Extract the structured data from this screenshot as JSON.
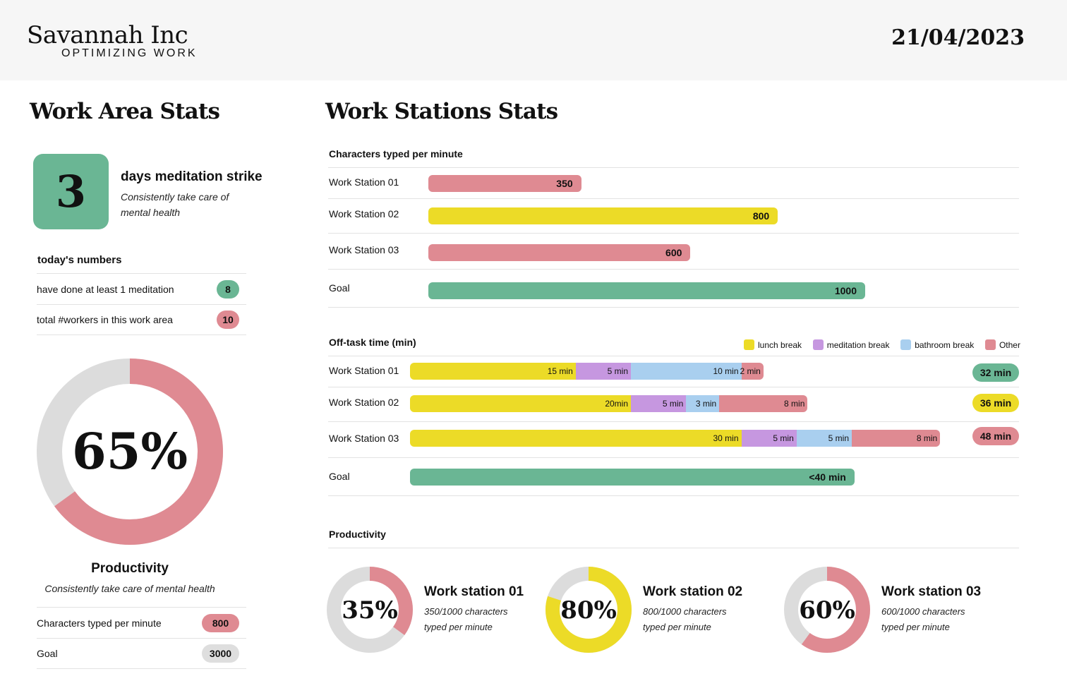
{
  "header": {
    "brand": "Savannah Inc",
    "tagline": "OPTIMIZING WORK",
    "date": "21/04/2023"
  },
  "work_area": {
    "title": "Work Area Stats",
    "streak": {
      "value": "3",
      "title": "days meditation strike",
      "subtitle": "Consistently take care of mental health"
    },
    "todays_numbers": {
      "title": "today's numbers",
      "rows": [
        {
          "label": "have done at least 1 meditation",
          "value": "8",
          "color": "#6ab694"
        },
        {
          "label": "total #workers in this work area",
          "value": "10",
          "color": "#df8a92"
        }
      ]
    },
    "productivity": {
      "percent_label": "65%",
      "percent": 65,
      "title": "Productivity",
      "subtitle": "Consistently take care of mental health",
      "rows": [
        {
          "label": "Characters typed per minute",
          "value": "800",
          "color": "#df8a92"
        },
        {
          "label": "Goal",
          "value": "3000",
          "color": "#dedede"
        }
      ]
    }
  },
  "work_stations": {
    "title": "Work Stations Stats",
    "cpm_chart": {
      "title": "Characters typed per minute",
      "max": 1000,
      "rows": [
        {
          "label": "Work Station 01",
          "value": 350,
          "value_label": "350",
          "color": "#df8a92"
        },
        {
          "label": "Work Station 02",
          "value": 800,
          "value_label": "800",
          "color": "#ecdb27"
        },
        {
          "label": "Work Station 03",
          "value": 600,
          "value_label": "600",
          "color": "#df8a92"
        },
        {
          "label": "Goal",
          "value": 1000,
          "value_label": "1000",
          "color": "#6ab694"
        }
      ]
    },
    "offtask_chart": {
      "title": "Off-task time (min)",
      "legend": [
        {
          "label": "lunch break",
          "color": "#ecdb27"
        },
        {
          "label": "meditation break",
          "color": "#c697e0"
        },
        {
          "label": "bathroom break",
          "color": "#a9cfef"
        },
        {
          "label": "Other",
          "color": "#df8a92"
        }
      ],
      "rows": [
        {
          "label": "Work Station 01",
          "total": "32 min",
          "total_color": "#6ab694",
          "segments": [
            {
              "minutes": 15,
              "label": "15 min",
              "color": "#ecdb27"
            },
            {
              "minutes": 5,
              "label": "5 min",
              "color": "#c697e0"
            },
            {
              "minutes": 10,
              "label": "10 min",
              "color": "#a9cfef"
            },
            {
              "minutes": 2,
              "label": "2 min",
              "color": "#df8a92"
            }
          ]
        },
        {
          "label": "Work Station 02",
          "total": "36 min",
          "total_color": "#ecdb27",
          "segments": [
            {
              "minutes": 20,
              "label": "20min",
              "color": "#ecdb27"
            },
            {
              "minutes": 5,
              "label": "5 min",
              "color": "#c697e0"
            },
            {
              "minutes": 3,
              "label": "3 min",
              "color": "#a9cfef"
            },
            {
              "minutes": 8,
              "label": "8 min",
              "color": "#df8a92"
            }
          ]
        },
        {
          "label": "Work Station 03",
          "total": "48 min",
          "total_color": "#df8a92",
          "segments": [
            {
              "minutes": 30,
              "label": "30 min",
              "color": "#ecdb27"
            },
            {
              "minutes": 5,
              "label": "5 min",
              "color": "#c697e0"
            },
            {
              "minutes": 5,
              "label": "5 min",
              "color": "#a9cfef"
            },
            {
              "minutes": 8,
              "label": "8 min",
              "color": "#df8a92"
            }
          ]
        }
      ],
      "goal": {
        "label": "Goal",
        "minutes": 39,
        "value_label": "<40 min",
        "color": "#6ab694"
      }
    },
    "productivity": {
      "title": "Productivity",
      "stations": [
        {
          "percent": 35,
          "percent_label": "35%",
          "title": "Work station 01",
          "subtitle": "350/1000 characters typed per minute",
          "color": "#df8a92"
        },
        {
          "percent": 80,
          "percent_label": "80%",
          "title": "Work station 02",
          "subtitle": "800/1000 characters typed per minute",
          "color": "#ecdb27"
        },
        {
          "percent": 60,
          "percent_label": "60%",
          "title": "Work station 03",
          "subtitle": "600/1000 characters typed per minute",
          "color": "#df8a92"
        }
      ]
    }
  }
}
